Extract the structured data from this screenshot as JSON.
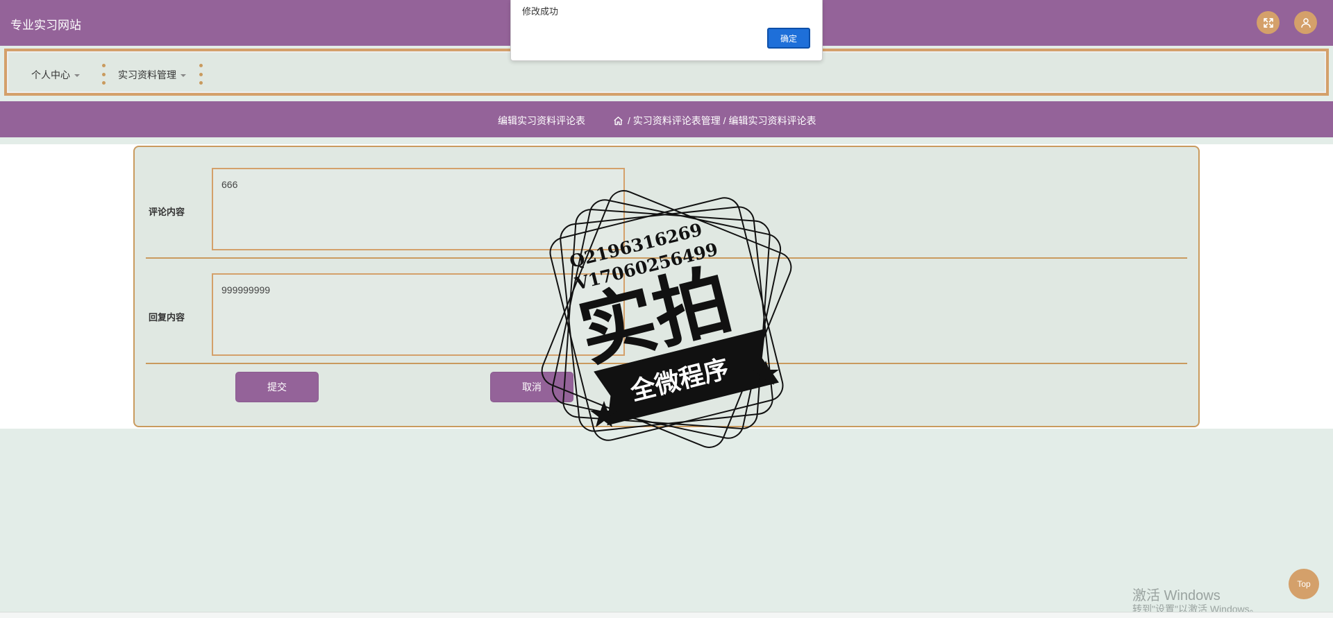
{
  "header": {
    "site_title": "专业实习网站",
    "fullscreen_icon": "expand-arrows-icon",
    "user_icon": "user-icon"
  },
  "menu": {
    "items": [
      {
        "label": "个人中心"
      },
      {
        "label": "实习资料管理"
      }
    ]
  },
  "breadcrumb": {
    "page_title": "编辑实习资料评论表",
    "home_icon": "home-icon",
    "path": "/ 实习资料评论表管理 / 编辑实习资料评论表"
  },
  "form": {
    "comment_label": "评论内容",
    "comment_value": "666",
    "reply_label": "回复内容",
    "reply_value": "999999999",
    "submit_label": "提交",
    "cancel_label": "取消"
  },
  "alert": {
    "message": "修改成功",
    "ok_label": "确定"
  },
  "watermark": {
    "line1": "Q2196316269",
    "line2": "V17060256499",
    "big_text": "实拍",
    "ribbon_text": "全微程序"
  },
  "floating": {
    "top_label": "Top"
  },
  "windows_activation": {
    "title": "激活 Windows",
    "subtitle": "转到\"设置\"以激活 Windows。"
  },
  "colors": {
    "primary": "#946399",
    "accent": "#d4a06a",
    "panel": "#e0e8e2",
    "dialog_button": "#1e6fd9"
  }
}
